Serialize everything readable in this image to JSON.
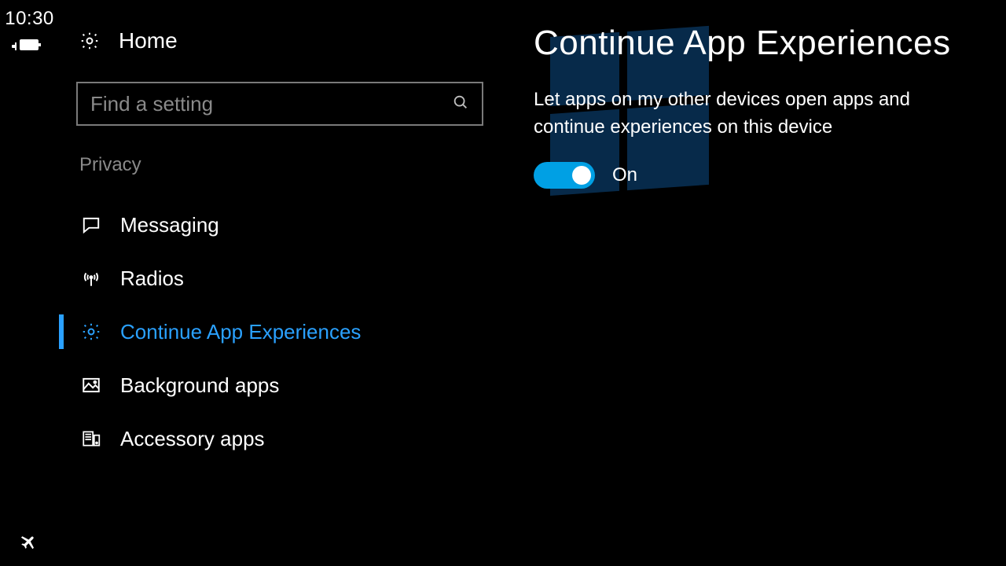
{
  "status": {
    "time": "10:30"
  },
  "sidebar": {
    "home_label": "Home",
    "search_placeholder": "Find a setting",
    "section_label": "Privacy",
    "items": [
      {
        "label": "Messaging"
      },
      {
        "label": "Radios"
      },
      {
        "label": "Continue App Experiences"
      },
      {
        "label": "Background apps"
      },
      {
        "label": "Accessory apps"
      }
    ]
  },
  "main": {
    "title": "Continue App Experiences",
    "description": "Let apps on my other devices open apps and continue experiences on this device",
    "toggle_state": "On"
  },
  "colors": {
    "accent": "#2aa1ff",
    "toggle": "#00a0e4"
  }
}
